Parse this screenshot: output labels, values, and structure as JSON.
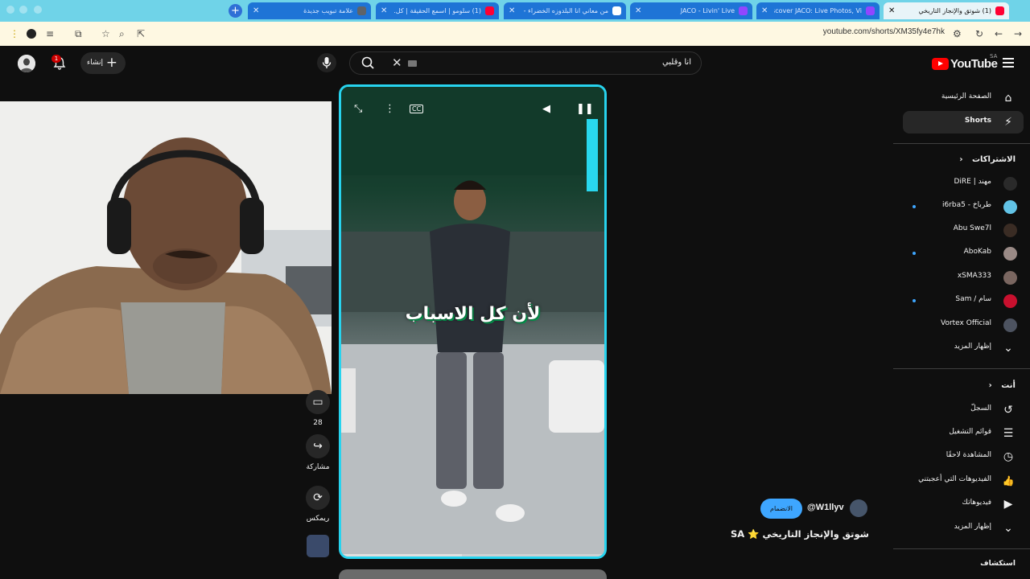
{
  "browser": {
    "tabs": [
      {
        "title": "علامة تبويب جديدة",
        "favicon_color": "#5f6368"
      },
      {
        "title": "(1) سلومو | اسمع الحقيقة | كل...",
        "favicon_color": "#ff0033"
      },
      {
        "title": "من معاني انا البلدوزه الخضراء - بحث",
        "favicon_color": "#ffffff"
      },
      {
        "title": "JACO - Livin' Live",
        "favicon_color": "#9146ff"
      },
      {
        "title": "Discover JACO: Live Photos, Vi...",
        "favicon_color": "#9146ff"
      },
      {
        "title": "(1) شوتق والإنجاز التاريخي",
        "favicon_color": "#ff0033"
      }
    ],
    "active_tab_index": 5,
    "url": "youtube.com/shorts/XM35fy4e7hk"
  },
  "youtube": {
    "logo_text": "YouTube",
    "country_code": "SA",
    "search_query": "انا وقلبي",
    "create_label": "إنشاء",
    "notification_count": "1"
  },
  "sidebar": {
    "main": [
      {
        "label": "الصفحة الرئيسية",
        "icon": "home-icon",
        "glyph": "⌂"
      },
      {
        "label": "Shorts",
        "icon": "shorts-icon",
        "glyph": "⚡"
      }
    ],
    "subscriptions_title": "الاشتراكات",
    "subscriptions": [
      {
        "label": "مهند | DiRE",
        "avatar_color": "#2a2a2a",
        "live_dot": false
      },
      {
        "label": "طرباخ - i6rba5",
        "avatar_color": "#62c3e6",
        "live_dot": true
      },
      {
        "label": "Abu Swe7l",
        "avatar_color": "#3a2c24",
        "live_dot": false
      },
      {
        "label": "AboKab",
        "avatar_color": "#9a8a86",
        "live_dot": true
      },
      {
        "label": "xSMA333",
        "avatar_color": "#7a6660",
        "live_dot": false
      },
      {
        "label": "سام / Sam",
        "avatar_color": "#c8102e",
        "live_dot": true
      },
      {
        "label": "Vortex Official",
        "avatar_color": "#4d5360",
        "live_dot": false
      }
    ],
    "show_more_label": "إظهار المزيد",
    "you_title": "أنت",
    "you_items": [
      {
        "label": "السجلّ",
        "icon": "history-icon",
        "glyph": "↺"
      },
      {
        "label": "قوائم التشغيل",
        "icon": "playlists-icon",
        "glyph": "☰"
      },
      {
        "label": "المشاهدة لاحقًا",
        "icon": "watch-later-icon",
        "glyph": "◷"
      },
      {
        "label": "الفيديوهات التي أعجبتني",
        "icon": "liked-icon",
        "glyph": "👍"
      },
      {
        "label": "فيديوهاتك",
        "icon": "your-videos-icon",
        "glyph": "▶"
      },
      {
        "label": "إظهار المزيد",
        "icon": "chevron-down-icon",
        "glyph": "⌄"
      }
    ],
    "explore_title": "استكشاف"
  },
  "player": {
    "caption": "لأن كل الاسباب",
    "progress": 0.46
  },
  "actions": {
    "comments_count": "28",
    "share_label": "مشاركة",
    "remix_label": "ريمكس"
  },
  "channel": {
    "handle": "@W1llyv",
    "join_label": "الانضمام",
    "video_title": "شوتق والإنجاز التاريخي ⭐ SA"
  }
}
